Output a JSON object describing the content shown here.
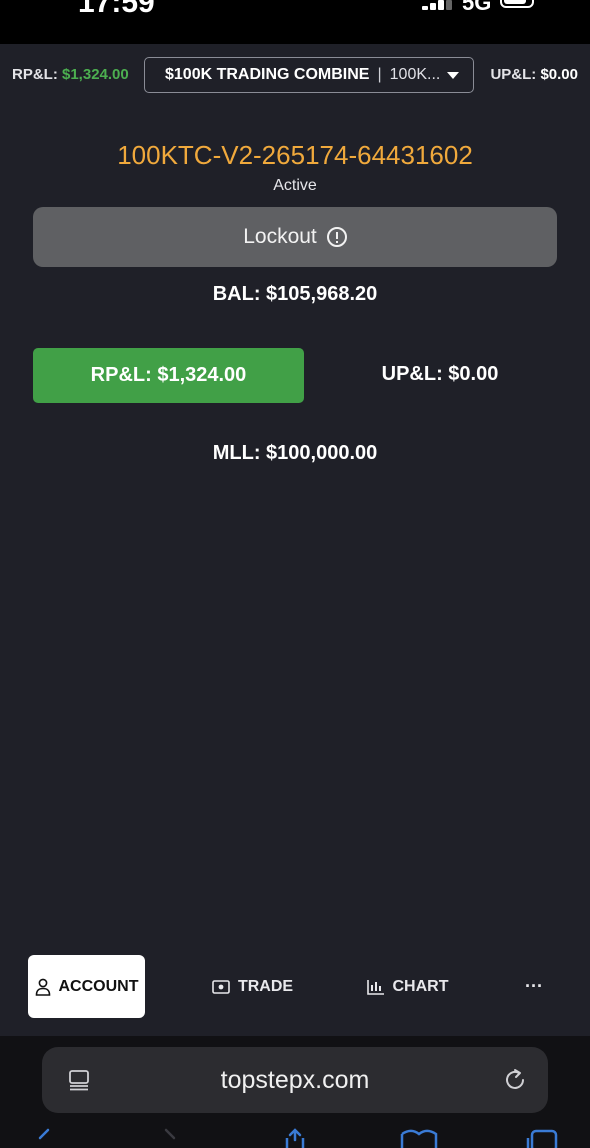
{
  "status_bar": {
    "time": "17:59",
    "network": "5G"
  },
  "topbar": {
    "rpl_label": "RP&L:",
    "rpl_value": "$1,324.00",
    "account_select": {
      "name": "$100K TRADING COMBINE",
      "separator": "|",
      "short": "100K..."
    },
    "upl_label": "UP&L:",
    "upl_value": "$0.00",
    "colors": {
      "positive": "#4caf50"
    }
  },
  "account": {
    "id": "100KTC-V2-265174-64431602",
    "status": "Active",
    "lockout_label": "Lockout",
    "balance": "BAL: $105,968.20",
    "rpl": "RP&L: $1,324.00",
    "upl": "UP&L: $0.00",
    "mll": "MLL: $100,000.00",
    "colors": {
      "id": "#f0a93c",
      "rpl_button": "#41a047",
      "lockout_button": "#5f6063"
    }
  },
  "bottom_nav": {
    "items": [
      {
        "label": "ACCOUNT",
        "icon": "person-icon",
        "active": true
      },
      {
        "label": "TRADE",
        "icon": "cash-icon",
        "active": false
      },
      {
        "label": "CHART",
        "icon": "chart-icon",
        "active": false
      },
      {
        "label": "···",
        "icon": "more-icon",
        "active": false
      }
    ]
  },
  "browser": {
    "url": "topstepx.com"
  }
}
